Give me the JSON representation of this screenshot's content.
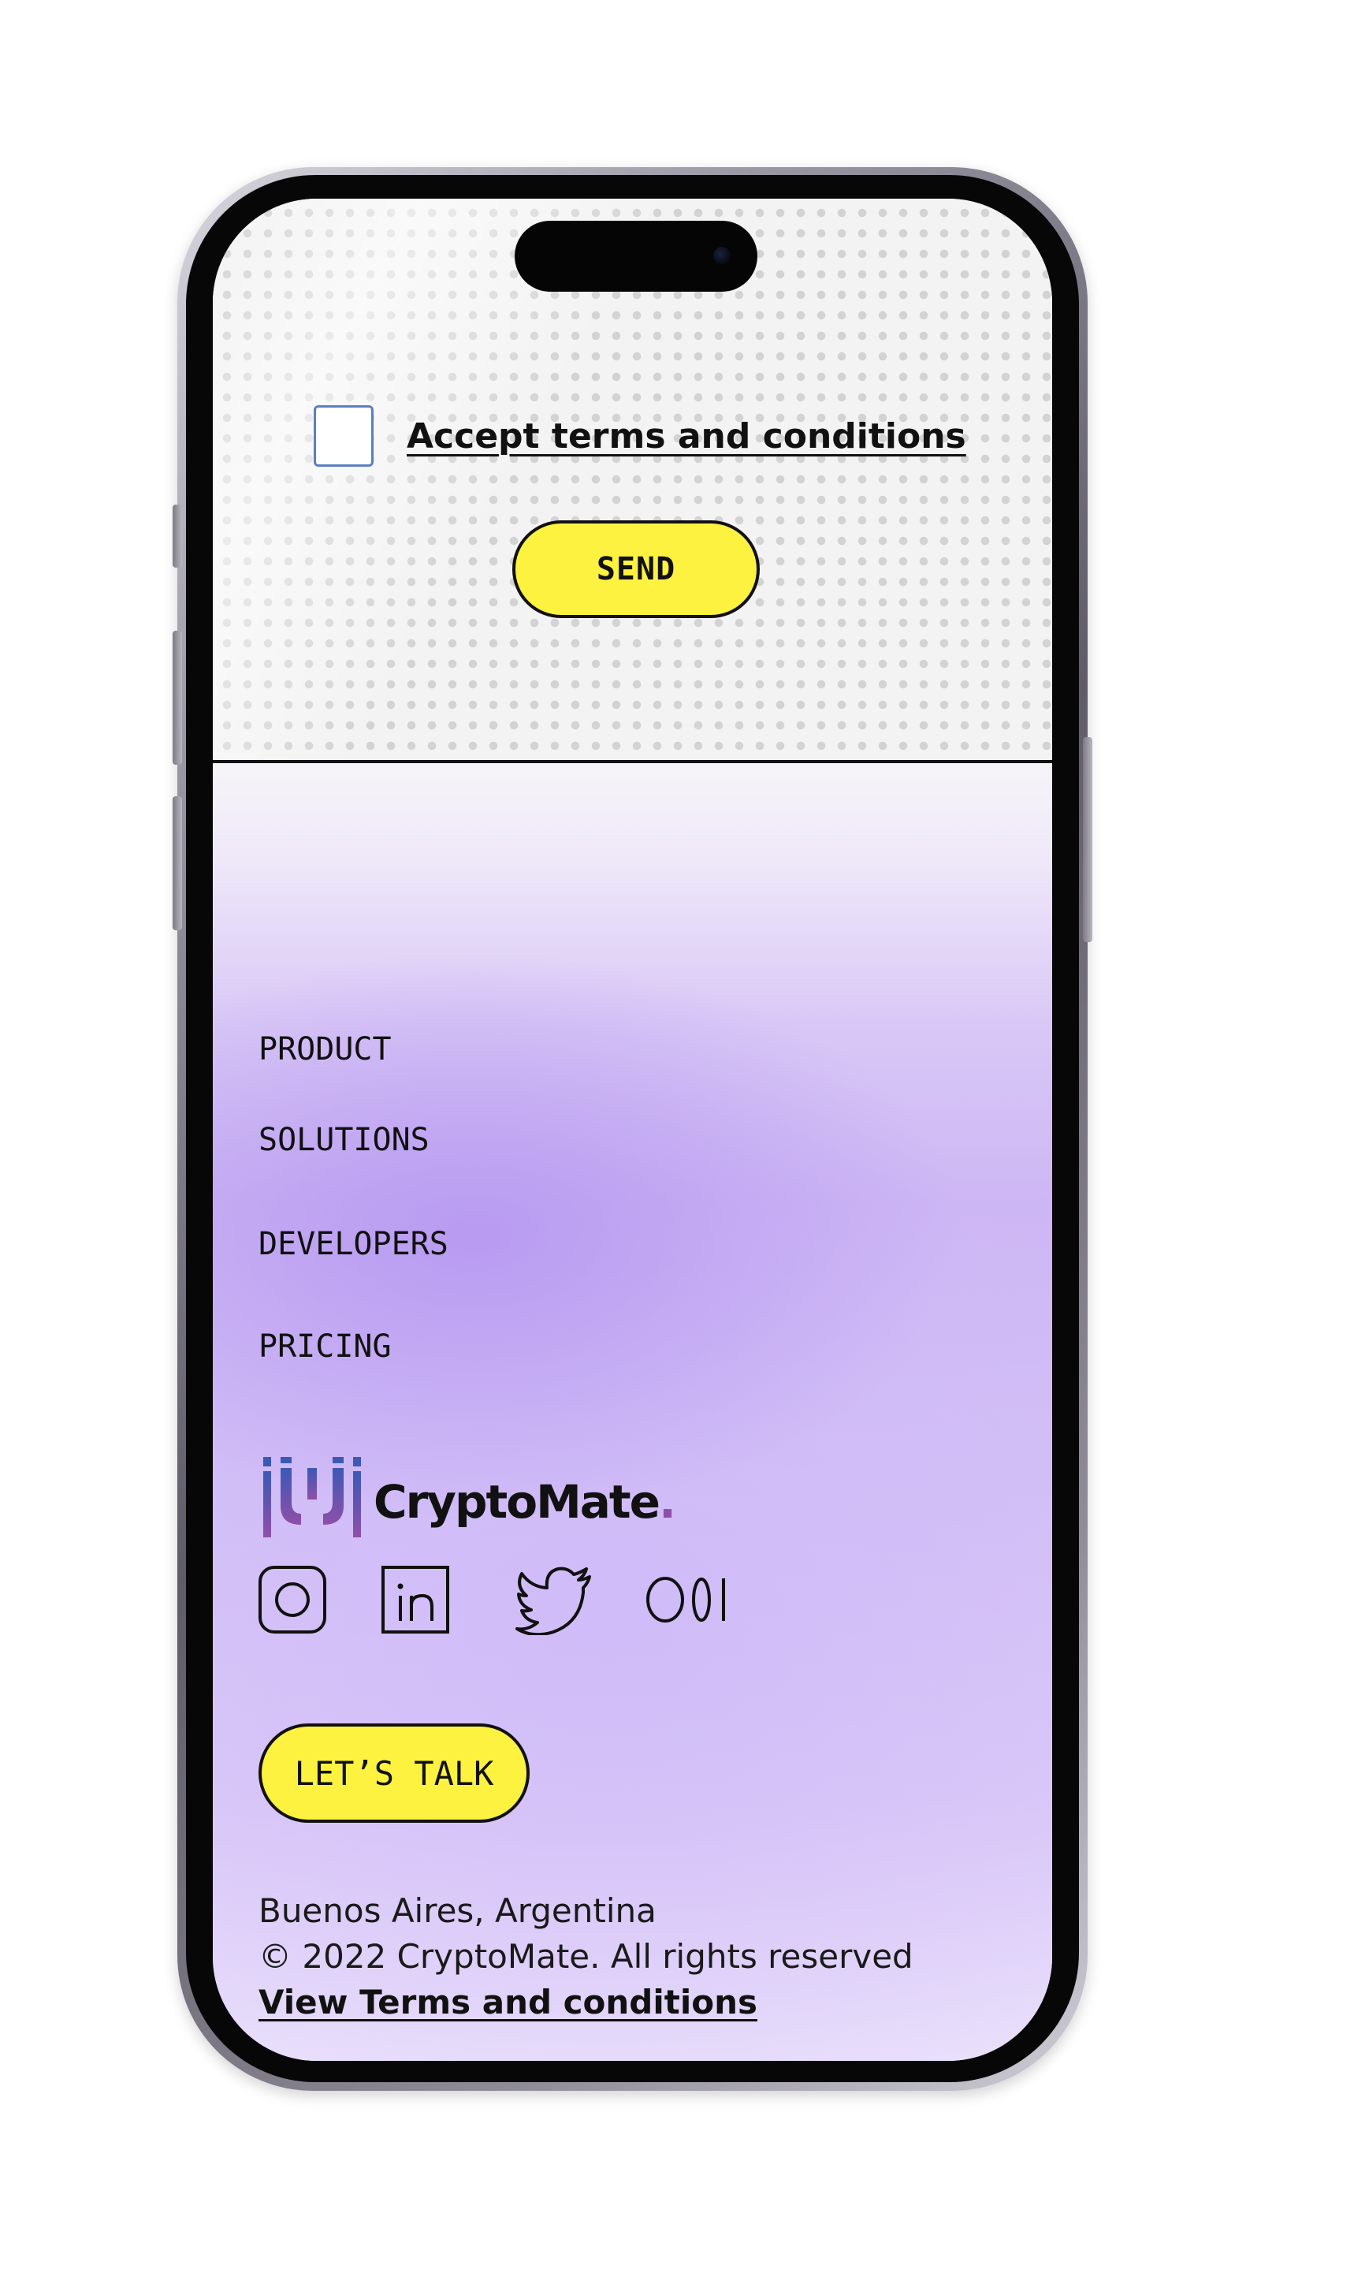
{
  "form": {
    "checkbox_checked": false,
    "terms_label": "Accept terms and conditions",
    "send_label": "SEND"
  },
  "footer": {
    "nav": [
      "PRODUCT",
      "SOLUTIONS",
      "DEVELOPERS",
      "PRICING"
    ],
    "brand": {
      "name": "CryptoMate",
      "dot": "."
    },
    "social_icons": [
      "instagram-icon",
      "linkedin-icon",
      "twitter-icon",
      "medium-icon"
    ],
    "cta_label": "LET’S TALK",
    "location": "Buenos Aires, Argentina",
    "copyright": "© 2022 CryptoMate. All rights reserved",
    "terms_link": "View Terms and conditions"
  },
  "colors": {
    "accent_yellow": "#fdf23f",
    "lavender": "#cdb6f4",
    "ink": "#111111",
    "checkbox_border": "#5b7fc0",
    "logo_gradient_start": "#3c59b5",
    "logo_gradient_end": "#8f4fa8"
  }
}
